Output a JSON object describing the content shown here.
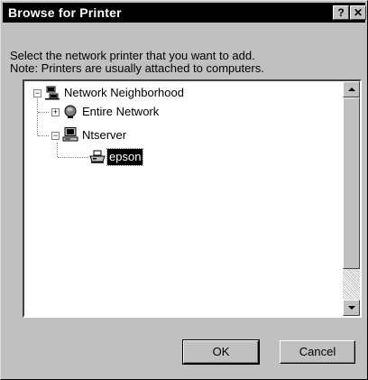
{
  "window": {
    "title": "Browse for Printer",
    "help_glyph": "?",
    "close_glyph": "✕"
  },
  "instructions": {
    "line1": "Select the network printer that you want to add.",
    "line2": "Note: Printers are usually attached to computers."
  },
  "tree": {
    "nodes": [
      {
        "label": "Network Neighborhood",
        "expander": "−",
        "icon": "network-neighborhood-icon"
      },
      {
        "label": "Entire Network",
        "expander": "+",
        "icon": "globe-icon"
      },
      {
        "label": "Ntserver",
        "expander": "−",
        "icon": "computer-icon"
      },
      {
        "label": "epson",
        "expander": "",
        "icon": "printer-icon",
        "selected": true
      }
    ]
  },
  "buttons": {
    "ok": "OK",
    "cancel": "Cancel"
  },
  "colors": {
    "face": "#c0c0c0",
    "titlebar": "#000000",
    "selection": "#000000"
  }
}
